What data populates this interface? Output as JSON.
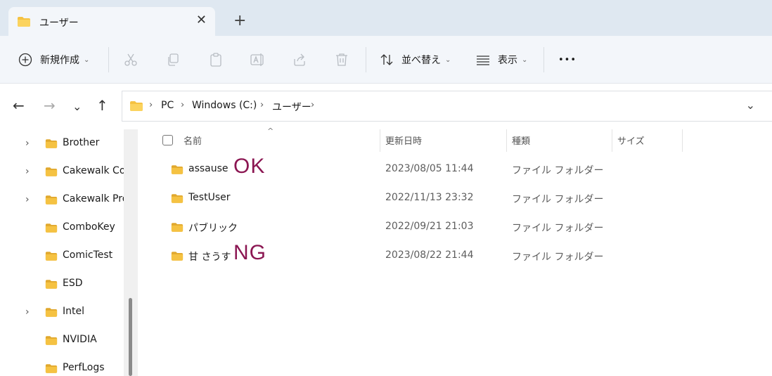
{
  "tab": {
    "title": "ユーザー",
    "close": "✕",
    "new": "+"
  },
  "toolbar": {
    "new_label": "新規作成",
    "sort_label": "並べ替え",
    "view_label": "表示",
    "more": "•••"
  },
  "address": {
    "crumbs": [
      "PC",
      "Windows (C:)",
      "ユーザー"
    ]
  },
  "sidebar": {
    "items": [
      {
        "label": "Brother",
        "expandable": true
      },
      {
        "label": "Cakewalk Core",
        "expandable": true
      },
      {
        "label": "Cakewalk Projects",
        "expandable": true
      },
      {
        "label": "ComboKey",
        "expandable": false
      },
      {
        "label": "ComicTest",
        "expandable": false
      },
      {
        "label": "ESD",
        "expandable": false
      },
      {
        "label": "Intel",
        "expandable": true
      },
      {
        "label": "NVIDIA",
        "expandable": false
      },
      {
        "label": "PerfLogs",
        "expandable": false
      }
    ]
  },
  "columns": {
    "name": "名前",
    "date": "更新日時",
    "type": "種類",
    "size": "サイズ"
  },
  "files": [
    {
      "name": "assause",
      "date": "2023/08/05 11:44",
      "type": "ファイル フォルダー",
      "note": "OK"
    },
    {
      "name": "TestUser",
      "date": "2022/11/13 23:32",
      "type": "ファイル フォルダー",
      "note": ""
    },
    {
      "name": "パブリック",
      "date": "2022/09/21 21:03",
      "type": "ファイル フォルダー",
      "note": ""
    },
    {
      "name": "甘 さうす",
      "date": "2023/08/22 21:44",
      "type": "ファイル フォルダー",
      "note": "NG"
    }
  ],
  "colors": {
    "folder": "#f5c242",
    "folder_dark": "#e0a82e",
    "annotation": "#8b1652"
  }
}
